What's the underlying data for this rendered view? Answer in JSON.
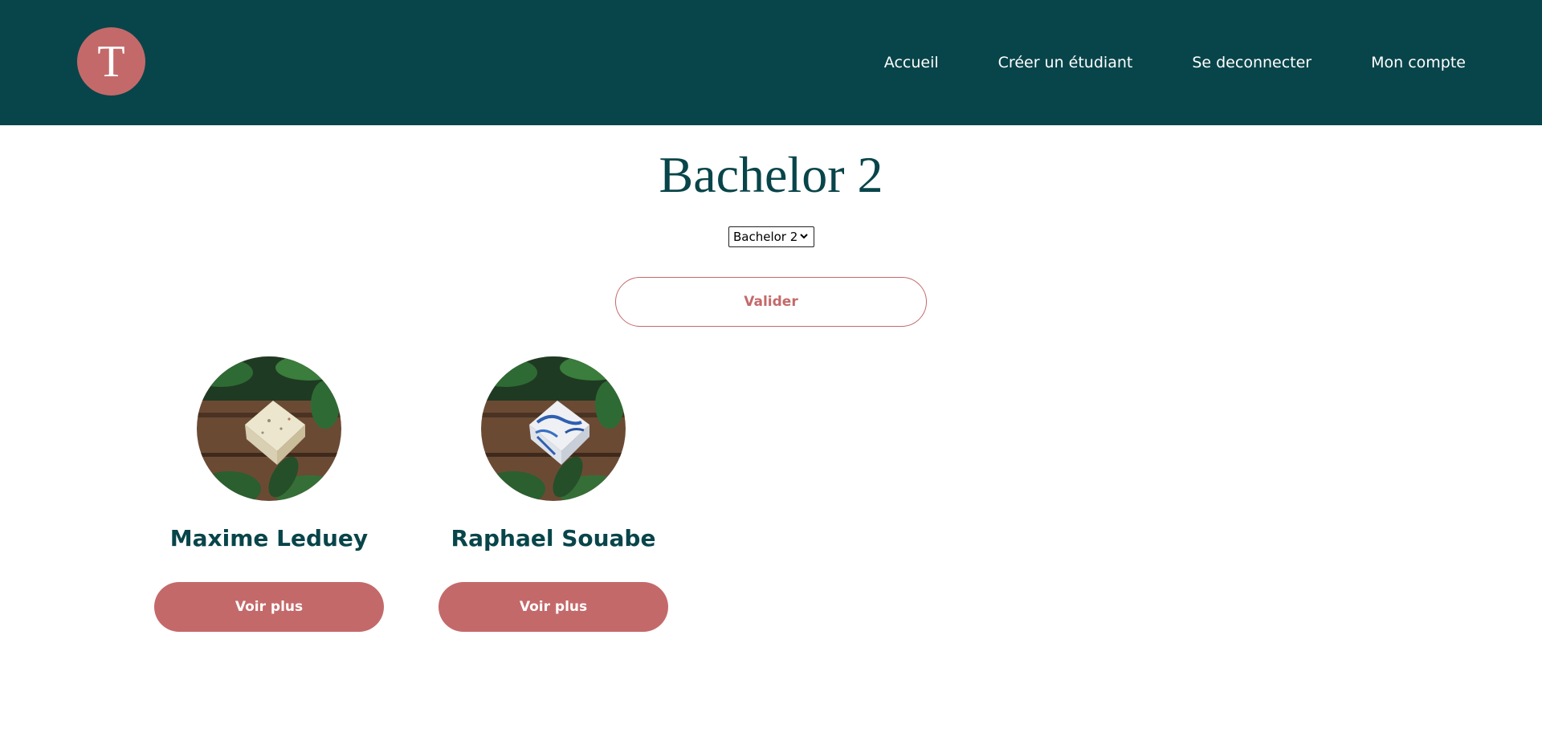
{
  "header": {
    "logo_letter": "T",
    "nav": [
      {
        "label": "Accueil"
      },
      {
        "label": "Créer un étudiant"
      },
      {
        "label": "Se deconnecter"
      },
      {
        "label": "Mon compte"
      }
    ]
  },
  "page": {
    "title": "Bachelor 2",
    "select": {
      "selected": "Bachelor 2"
    },
    "validate_label": "Valider"
  },
  "students": [
    {
      "name": "Maxime Leduey",
      "button_label": "Voir plus",
      "soap_color": "white-speckled"
    },
    {
      "name": "Raphael Souabe",
      "button_label": "Voir plus",
      "soap_color": "blue-marbled"
    }
  ],
  "colors": {
    "header_bg": "#08454a",
    "accent": "#c4696a",
    "title": "#08454a"
  }
}
